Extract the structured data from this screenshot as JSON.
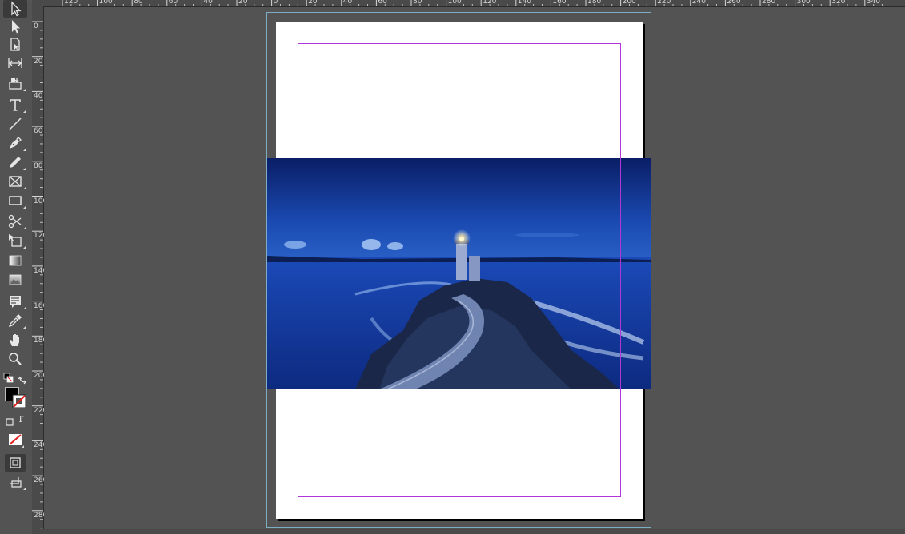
{
  "toolbar": {
    "tools": [
      {
        "name": "selection-tool-icon",
        "active": true
      },
      {
        "name": "direct-selection-tool-icon"
      },
      {
        "name": "page-tool-icon"
      },
      {
        "name": "gap-tool-icon"
      },
      {
        "name": "content-collector-tool-icon"
      },
      {
        "name": "type-tool-icon"
      },
      {
        "name": "line-tool-icon"
      },
      {
        "name": "pen-tool-icon"
      },
      {
        "name": "pencil-tool-icon"
      },
      {
        "name": "rectangle-frame-tool-icon"
      },
      {
        "name": "rectangle-tool-icon"
      },
      {
        "name": "scissors-tool-icon"
      },
      {
        "name": "free-transform-tool-icon"
      },
      {
        "name": "gradient-swatch-tool-icon"
      },
      {
        "name": "gradient-feather-tool-icon"
      },
      {
        "name": "note-tool-icon"
      },
      {
        "name": "eyedropper-tool-icon"
      },
      {
        "name": "hand-tool-icon"
      },
      {
        "name": "zoom-tool-icon"
      }
    ],
    "type_toggle_label": "T"
  },
  "ruler_top": {
    "labels": [
      "120",
      "100",
      "80",
      "60",
      "40",
      "20",
      "0",
      "20",
      "40",
      "60",
      "80",
      "100",
      "120",
      "140",
      "160",
      "180",
      "200",
      "220",
      "240",
      "260",
      "280",
      "300",
      "320",
      "340"
    ]
  },
  "ruler_left": {
    "labels": [
      "0",
      "20",
      "40",
      "60",
      "80",
      "100",
      "120",
      "140",
      "160",
      "180",
      "200",
      "220",
      "240",
      "260",
      "280"
    ]
  },
  "colors": {
    "interface": "#535353",
    "page": "#ffffff",
    "margin_guide": "#b136d8",
    "bleed_guide": "#7faec4",
    "fill_swatch": "#000000",
    "stroke_none": "#e02020"
  },
  "canvas": {
    "image_subject": "lighthouse-at-blue-hour"
  }
}
